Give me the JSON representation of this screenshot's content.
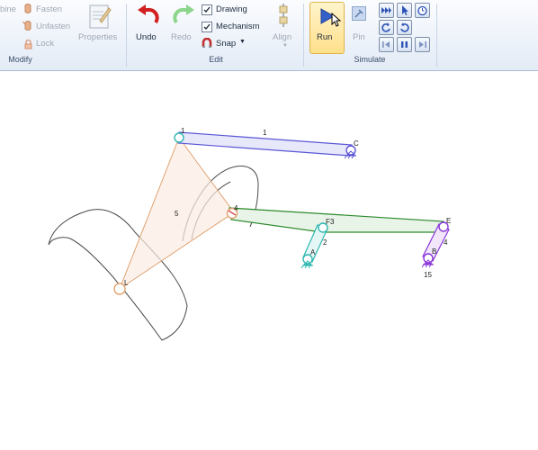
{
  "ribbon": {
    "modify": {
      "combine_label": "bine",
      "fasten_label": "Fasten",
      "unfasten_label": "Unfasten",
      "lock_label": "Lock",
      "properties_label": "Properties",
      "group_label": "Modify"
    },
    "edit": {
      "undo_label": "Undo",
      "redo_label": "Redo",
      "drawing_label": "Drawing",
      "drawing_checked": true,
      "mechanism_label": "Mechanism",
      "mechanism_checked": true,
      "snap_label": "Snap",
      "align_label": "Align",
      "group_label": "Edit"
    },
    "simulate": {
      "run_label": "Run",
      "pin_label": "Pin",
      "group_label": "Simulate"
    }
  },
  "canvas": {
    "links": [
      {
        "name": "link-1",
        "label": "1",
        "color": "#5a56d6"
      },
      {
        "name": "link-2",
        "label": "2",
        "color": "#2fb7b0"
      },
      {
        "name": "link-4",
        "label": "4",
        "color": "#8a37d8"
      },
      {
        "name": "link-5",
        "label": "5",
        "color": "#e0a270"
      },
      {
        "name": "link-3",
        "label": "3",
        "color": "#2b8a2b"
      }
    ],
    "joint_labels": {
      "c": "C",
      "f": "F",
      "e": "E",
      "a": "A",
      "b": "B",
      "l": "L",
      "top": "1",
      "mid": "4"
    },
    "link_number_15": "15"
  }
}
